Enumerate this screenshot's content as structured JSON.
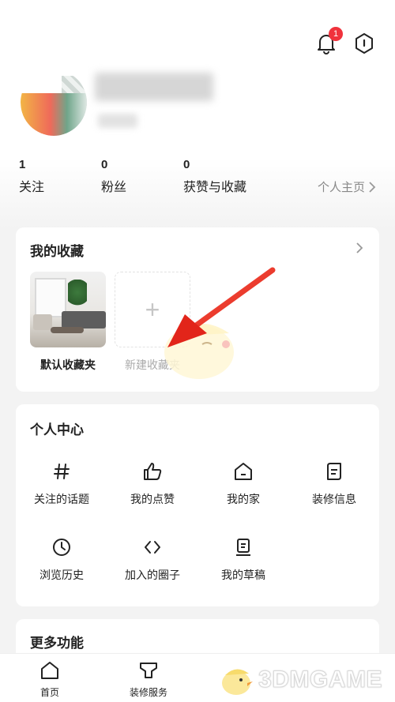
{
  "header": {
    "notification_count": "1"
  },
  "stats": [
    {
      "count": "1",
      "label": "关注"
    },
    {
      "count": "0",
      "label": "粉丝"
    },
    {
      "count": "0",
      "label": "获赞与收藏"
    }
  ],
  "homepage_link": "个人主页",
  "favorites": {
    "title": "我的收藏",
    "default_folder": "默认收藏夹",
    "new_folder": "新建收藏夹"
  },
  "personal_center": {
    "title": "个人中心",
    "items": [
      {
        "label": "关注的话题",
        "icon": "hashtag-icon"
      },
      {
        "label": "我的点赞",
        "icon": "thumbs-up-icon"
      },
      {
        "label": "我的家",
        "icon": "home-icon"
      },
      {
        "label": "装修信息",
        "icon": "document-icon"
      },
      {
        "label": "浏览历史",
        "icon": "clock-icon"
      },
      {
        "label": "加入的圈子",
        "icon": "code-icon"
      },
      {
        "label": "我的草稿",
        "icon": "draft-icon"
      }
    ]
  },
  "more": {
    "title": "更多功能"
  },
  "tabbar": {
    "tabs": [
      {
        "label": "首页",
        "icon": "home-icon"
      },
      {
        "label": "装修服务",
        "icon": "service-icon"
      }
    ]
  },
  "watermark": "3DMGAME",
  "colors": {
    "badge": "#f0323c",
    "arrow": "#e8281e",
    "background": "#f3f3f3"
  }
}
